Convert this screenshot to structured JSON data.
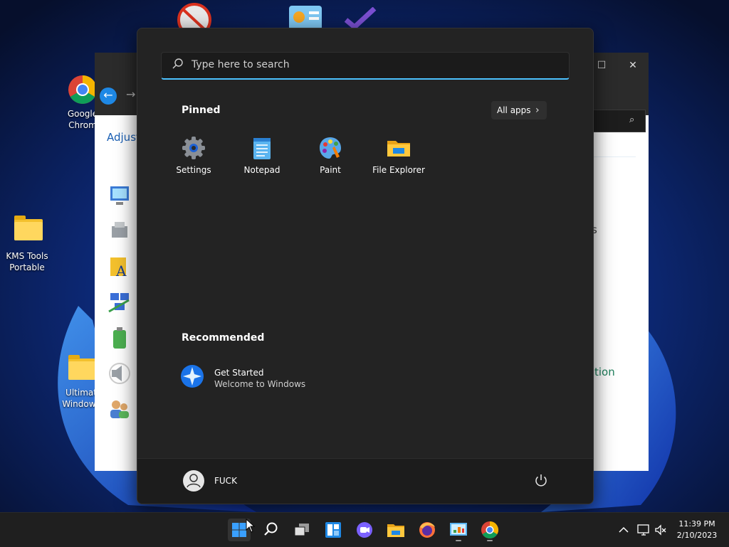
{
  "desktop": {
    "icons": [
      {
        "label_line1": "Google",
        "label_line2": "Chrom"
      },
      {
        "label_line1": "KMS Tools",
        "label_line2": "Portable"
      },
      {
        "label_line1": "Ultimat",
        "label_line2": "Windows"
      }
    ]
  },
  "background_window": {
    "heading_fragment": "Adjust",
    "side_fragment_1": "s",
    "side_fragment_2": "tion"
  },
  "start_menu": {
    "search_placeholder": "Type here to search",
    "pinned_title": "Pinned",
    "all_apps_label": "All apps",
    "pinned": [
      {
        "label": "Settings",
        "icon": "settings-icon"
      },
      {
        "label": "Notepad",
        "icon": "notepad-icon"
      },
      {
        "label": "Paint",
        "icon": "paint-icon"
      },
      {
        "label": "File Explorer",
        "icon": "file-explorer-icon"
      }
    ],
    "recommended_title": "Recommended",
    "recommended": [
      {
        "title": "Get Started",
        "subtitle": "Welcome to Windows",
        "icon": "get-started-icon"
      }
    ],
    "user_name": "FUCK"
  },
  "taskbar": {
    "apps": [
      "start",
      "search",
      "task-view",
      "widgets",
      "chat",
      "file-explorer",
      "firefox",
      "control-panel",
      "chrome"
    ],
    "time": "11:39 PM",
    "date": "2/10/2023"
  },
  "colors": {
    "accent": "#4cc2ff",
    "start_bg": "#232323",
    "taskbar_bg": "#1f1f1f"
  }
}
